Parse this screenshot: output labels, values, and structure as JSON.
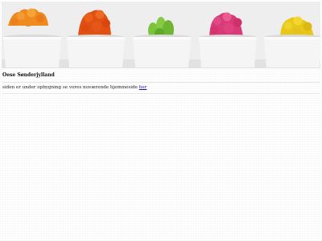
{
  "site": {
    "title": "Oese Sønderjylland"
  },
  "notice": {
    "text": "siden er under opbygning se vores nuværende hjemmeside",
    "link_label": "her"
  },
  "hero": {
    "plants": [
      {
        "name": "orange-cactus",
        "color": "#f08a1c"
      },
      {
        "name": "red-orange-cactus",
        "color": "#e24f12"
      },
      {
        "name": "green-cactus",
        "color": "#7cc23a"
      },
      {
        "name": "pink-cactus",
        "color": "#d93a78"
      },
      {
        "name": "yellow-cactus",
        "color": "#e8c719"
      }
    ],
    "pot_color": "#f4f4f4",
    "background_color": "#ececec"
  }
}
